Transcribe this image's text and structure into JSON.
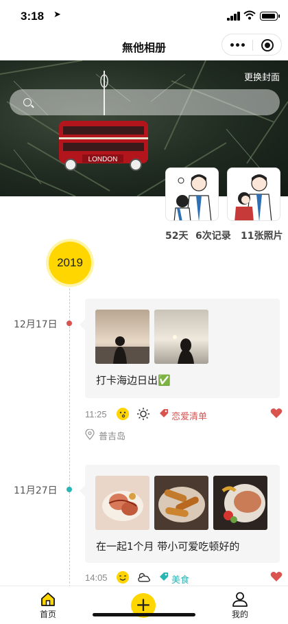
{
  "status_bar": {
    "time": "3:18",
    "location_glyph": "➤"
  },
  "nav": {
    "title": "無他相册"
  },
  "cover": {
    "change_label": "更换封面",
    "ornament_text": "LONDON"
  },
  "stats": {
    "days": "52天",
    "records": "6次记录",
    "photos": "11张照片"
  },
  "timeline": {
    "year": "2019",
    "entries": [
      {
        "date": "12月17日",
        "text": "打卡海边日出✅",
        "time": "11:25",
        "tag": "恋爱清单",
        "place": "普吉岛",
        "dot_color": "#d9534f",
        "tag_color": "#d9534f"
      },
      {
        "date": "11月27日",
        "text": "在一起1个月 带小可爱吃顿好的",
        "time": "14:05",
        "tag": "美食",
        "dot_color": "#2ab5b5",
        "tag_color": "#2ab5b5"
      }
    ]
  },
  "tabbar": {
    "home": "首页",
    "add": "+",
    "mine": "我的"
  },
  "colors": {
    "accent": "#ffd600",
    "heart": "#d9534f"
  }
}
